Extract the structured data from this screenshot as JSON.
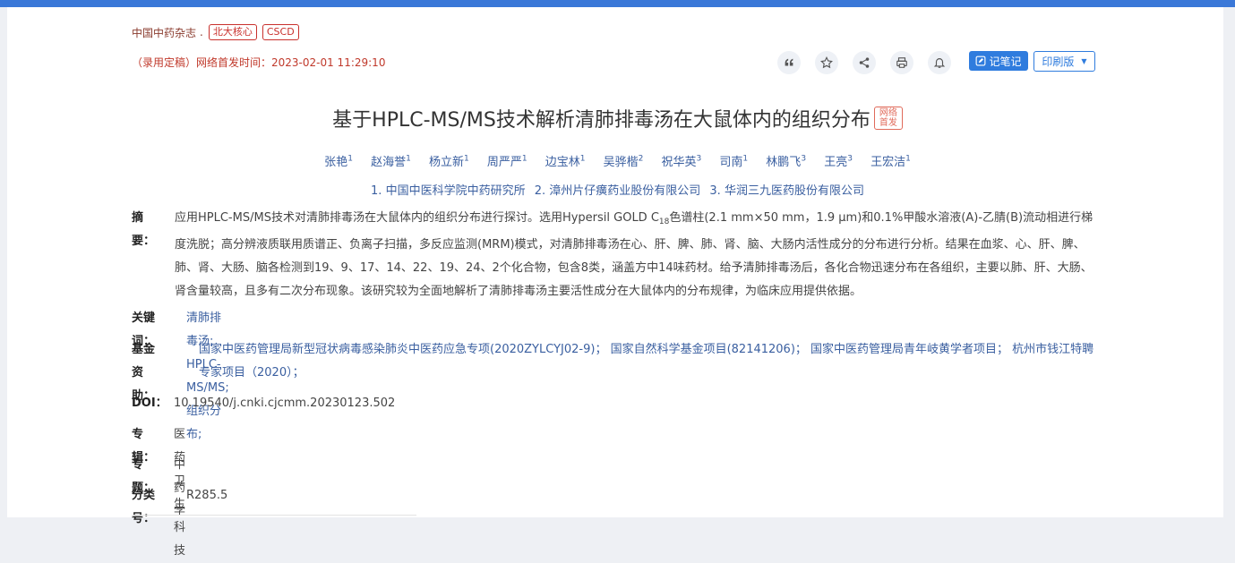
{
  "journal": {
    "name": "中国中药杂志",
    "dot": ".",
    "tags": [
      "北大核心",
      "CSCD"
    ]
  },
  "pubdate": "（录用定稿）网络首发时间：2023-02-01 11:29:10",
  "toolbar": {
    "icons": [
      "quote-icon",
      "star-icon",
      "share-icon",
      "print-icon",
      "bell-icon"
    ],
    "note_label": "记笔记",
    "print_label": "印刷版",
    "accent": "#2f7cde"
  },
  "title": "基于HPLC-MS/MS技术解析清肺排毒汤在大鼠体内的组织分布",
  "title_tag": [
    "网络",
    "首发"
  ],
  "authors": [
    {
      "name": "张艳",
      "sup": "1"
    },
    {
      "name": "赵海誉",
      "sup": "1"
    },
    {
      "name": "杨立新",
      "sup": "1"
    },
    {
      "name": "周严严",
      "sup": "1"
    },
    {
      "name": "边宝林",
      "sup": "1"
    },
    {
      "name": "吴骅楷",
      "sup": "2"
    },
    {
      "name": "祝华英",
      "sup": "3"
    },
    {
      "name": "司南",
      "sup": "1"
    },
    {
      "name": "林鹏飞",
      "sup": "3"
    },
    {
      "name": "王亮",
      "sup": "3"
    },
    {
      "name": "王宏洁",
      "sup": "1"
    }
  ],
  "affiliations": [
    "1. 中国中医科学院中药研究所",
    "2. 漳州片仔癀药业股份有限公司",
    "3. 华润三九医药股份有限公司"
  ],
  "abstract": {
    "label": "摘要：",
    "pre": "应用HPLC-MS/MS技术对清肺排毒汤在大鼠体内的组织分布进行探讨。选用Hypersil GOLD C",
    "sub": "18",
    "post": "色谱柱(2.1 mm×50 mm，1.9 μm)和0.1%甲酸水溶液(A)-乙腈(B)流动相进行梯度洗脱；高分辨液质联用质谱正、负离子扫描，多反应监测(MRM)模式，对清肺排毒汤在心、肝、脾、肺、肾、脑、大肠内活性成分的分布进行分析。结果在血浆、心、肝、脾、肺、肾、大肠、脑各检测到19、9、17、14、22、19、24、2个化合物，包含8类，涵盖方中14味药材。给予清肺排毒汤后，各化合物迅速分布在各组织，主要以肺、肝、大肠、肾含量较高，且多有二次分布现象。该研究较为全面地解析了清肺排毒汤主要活性成分在大鼠体内的分布规律，为临床应用提供依据。"
  },
  "keywords": {
    "label": "关键词：",
    "items": [
      "清肺排毒汤;",
      "HPLC-MS/MS;",
      "组织分布;"
    ]
  },
  "funding": {
    "label": "基金资助：",
    "text": "国家中医药管理局新型冠状病毒感染肺炎中医药应急专项(2020ZYLCYJ02-9)； 国家自然科学基金项目(82141206)； 国家中医药管理局青年岐黄学者项目； 杭州市钱江特聘专家项目（2020）；"
  },
  "doi": {
    "label": "DOI：",
    "value": "10.19540/j.cnki.cjcmm.20230123.502"
  },
  "column": {
    "label": "专辑：",
    "value": "医药卫生科技"
  },
  "topic": {
    "label": "专题：",
    "value": "中药学"
  },
  "classno": {
    "label": "分类号：",
    "value": "R285.5"
  }
}
